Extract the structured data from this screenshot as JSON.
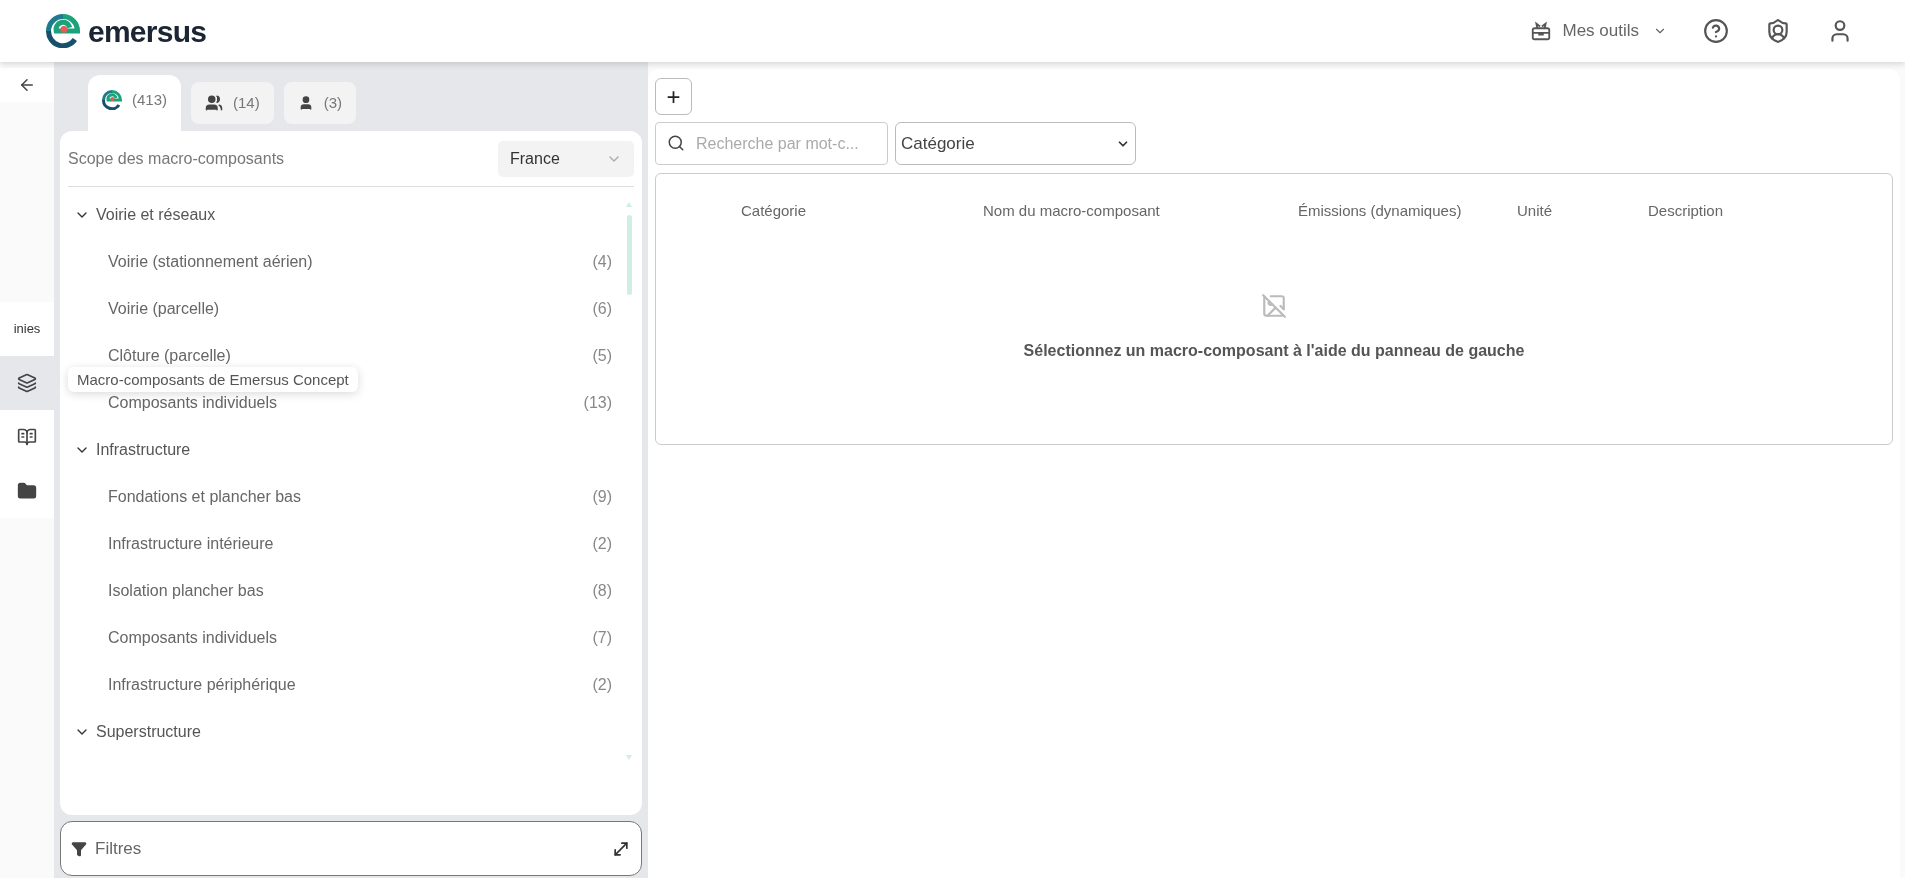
{
  "header": {
    "logo": "emersus",
    "tools_menu": "Mes outils"
  },
  "rail": [
    {
      "kind": "inies",
      "label": "inies",
      "selected": false
    },
    {
      "kind": "layers",
      "selected": true
    },
    {
      "kind": "library",
      "selected": false
    },
    {
      "kind": "folder",
      "selected": false
    }
  ],
  "tooltip": "Macro-composants de Emersus Concept",
  "tabs": [
    {
      "kind": "emersus",
      "count": "(413)",
      "selected": true
    },
    {
      "kind": "group",
      "count": "(14)",
      "selected": false
    },
    {
      "kind": "user",
      "count": "(3)",
      "selected": false
    }
  ],
  "scope": {
    "label": "Scope des macro-composants",
    "value": "France"
  },
  "tree": [
    {
      "label": "Voirie et réseaux",
      "expanded": true,
      "children": [
        {
          "label": "Voirie (stationnement aérien)",
          "count": "(4)"
        },
        {
          "label": "Voirie (parcelle)",
          "count": "(6)"
        },
        {
          "label": "Clôture (parcelle)",
          "count": "(5)"
        },
        {
          "label": "Composants individuels",
          "count": "(13)"
        }
      ]
    },
    {
      "label": "Infrastructure",
      "expanded": true,
      "children": [
        {
          "label": "Fondations et plancher bas",
          "count": "(9)"
        },
        {
          "label": "Infrastructure intérieure",
          "count": "(2)"
        },
        {
          "label": "Isolation plancher bas",
          "count": "(8)"
        },
        {
          "label": "Composants individuels",
          "count": "(7)"
        },
        {
          "label": "Infrastructure périphérique",
          "count": "(2)"
        }
      ]
    },
    {
      "label": "Superstructure",
      "expanded": true
    }
  ],
  "filters": "Filtres",
  "toolbar": {
    "add": "+",
    "search_placeholder": "Recherche par mot-c...",
    "category_select": "Catégorie"
  },
  "table": {
    "columns": [
      "Catégorie",
      "Nom du macro-composant",
      "Émissions (dynamiques)",
      "Unité",
      "Description"
    ],
    "empty_message": "Sélectionnez un macro-composant à l'aide du panneau de gauche"
  }
}
